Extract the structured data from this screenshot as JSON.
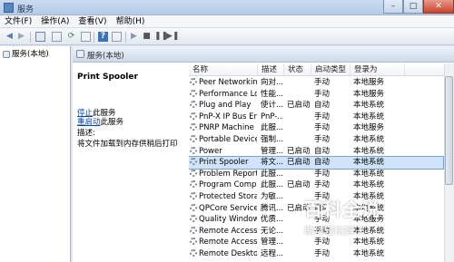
{
  "window": {
    "title": "服务"
  },
  "menu": [
    "文件(F)",
    "操作(A)",
    "查看(V)",
    "帮助(H)"
  ],
  "left_pane": {
    "item": "服务(本地)"
  },
  "pane_header": {
    "title": "服务(本地)"
  },
  "detail": {
    "service_title": "Print Spooler",
    "stop_link": "停止",
    "stop_suffix": "此服务",
    "restart_link": "重启动",
    "restart_suffix": "此服务",
    "desc_label": "描述:",
    "desc_text": "将文件加载到内存供稍后打印"
  },
  "columns": {
    "name": "名称",
    "desc": "描述",
    "status": "状态",
    "startup": "启动类型",
    "logon": "登录为"
  },
  "services": [
    {
      "name": "Peer Networkin...",
      "desc": "向对...",
      "status": "",
      "startup": "手动",
      "logon": "本地服务"
    },
    {
      "name": "Performance Lo...",
      "desc": "性能...",
      "status": "",
      "startup": "手动",
      "logon": "本地服务"
    },
    {
      "name": "Plug and Play",
      "desc": "使计...",
      "status": "已启动",
      "startup": "自动",
      "logon": "本地系统"
    },
    {
      "name": "PnP-X IP Bus En...",
      "desc": "PnP-...",
      "status": "",
      "startup": "手动",
      "logon": "本地系统"
    },
    {
      "name": "PNRP Machine ...",
      "desc": "此服...",
      "status": "",
      "startup": "手动",
      "logon": "本地服务"
    },
    {
      "name": "Portable Device ...",
      "desc": "强制...",
      "status": "",
      "startup": "手动",
      "logon": "本地系统"
    },
    {
      "name": "Power",
      "desc": "管理...",
      "status": "已启动",
      "startup": "自动",
      "logon": "本地系统"
    },
    {
      "name": "Print Spooler",
      "desc": "将文...",
      "status": "已启动",
      "startup": "自动",
      "logon": "本地系统",
      "selected": true
    },
    {
      "name": "Problem Report...",
      "desc": "此服...",
      "status": "",
      "startup": "手动",
      "logon": "本地系统"
    },
    {
      "name": "Program Compa...",
      "desc": "此服...",
      "status": "已启动",
      "startup": "手动",
      "logon": "本地系统"
    },
    {
      "name": "Protected Storage",
      "desc": "为敏...",
      "status": "",
      "startup": "手动",
      "logon": "本地系统"
    },
    {
      "name": "QPCore Service",
      "desc": "腾讯...",
      "status": "已启动",
      "startup": "自动",
      "logon": "本地系统"
    },
    {
      "name": "Quality Windows...",
      "desc": "优质...",
      "status": "",
      "startup": "手动",
      "logon": "本地服务"
    },
    {
      "name": "Remote Access ...",
      "desc": "无论...",
      "status": "",
      "startup": "手动",
      "logon": "本地系统"
    },
    {
      "name": "Remote Access ...",
      "desc": "管理...",
      "status": "",
      "startup": "手动",
      "logon": "本地系统"
    },
    {
      "name": "Remote Deskto...",
      "desc": "远程...",
      "status": "",
      "startup": "手动",
      "logon": "本地系统"
    }
  ],
  "watermark": {
    "title": "百科全说",
    "subtitle": "助你轻松解决"
  }
}
